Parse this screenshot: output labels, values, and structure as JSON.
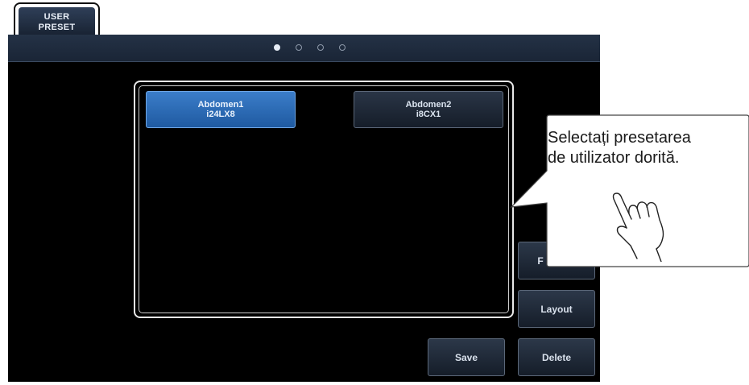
{
  "header": {
    "user_preset_label": "USER\nPRESET"
  },
  "pagination": {
    "pages": 4,
    "active": 0
  },
  "presets": [
    {
      "name": "Abdomen1",
      "probe": "i24LX8",
      "selected": true
    },
    {
      "name": "Abdomen2",
      "probe": "i8CX1",
      "selected": false
    }
  ],
  "buttons": {
    "f_label": "F",
    "layout_label": "Layout",
    "save_label": "Save",
    "delete_label": "Delete"
  },
  "callout": {
    "line1": "Selectați presetarea",
    "line2": "de utilizator dorită."
  },
  "colors": {
    "selected_preset": "#2c6bb5",
    "screen_background": "#000000",
    "topbar": "#1f2b3d"
  },
  "icons": [
    "pointing-hand-icon"
  ]
}
